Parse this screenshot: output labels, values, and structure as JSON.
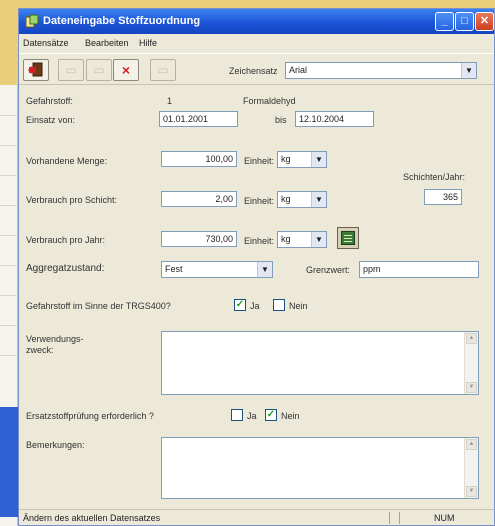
{
  "window": {
    "title": "Dateneingabe Stoffzuordnung"
  },
  "menu": [
    "Datensätze",
    "Bearbeiten",
    "Hilfe"
  ],
  "toolbar": {
    "delete_label": "×",
    "font_label": "Zeichensatz",
    "font_value": "Arial"
  },
  "form": {
    "gefahrstoff_label": "Gefahrstoff:",
    "gefahrstoff_value": "1",
    "gefahrstoff_name": "Formaldehyd",
    "einsatz_label": "Einsatz von:",
    "einsatz_von": "01.01.2001",
    "bis_label": "bis",
    "einsatz_bis": "12.10.2004",
    "menge_label": "Vorhandene Menge:",
    "menge_value": "100,00",
    "einheit_label": "Einheit:",
    "einheit_menge": "kg",
    "schichten_label": "Schichten/Jahr:",
    "schichten_value": "365",
    "schicht_label": "Verbrauch pro Schicht:",
    "schicht_value": "2,00",
    "einheit_schicht": "kg",
    "jahr_label": "Verbrauch pro Jahr:",
    "jahr_value": "730,00",
    "einheit_jahr": "kg",
    "aggregat_label": "Aggregatzustand:",
    "aggregat_value": "Fest",
    "grenzwert_label": "Grenzwert:",
    "grenzwert_value": "ppm",
    "trgs_label": "Gefahrstoff im Sinne der TRGS400?",
    "trgs_ja_label": "Ja",
    "trgs_ja": true,
    "trgs_nein_label": "Nein",
    "trgs_nein": false,
    "zweck_label": "Verwendungs- zweck:",
    "ersatz_label": "Ersatzstoffprüfung erforderlich ?",
    "ersatz_ja_label": "Ja",
    "ersatz_ja": false,
    "ersatz_nein_label": "Nein",
    "ersatz_nein": true,
    "bemerkungen_label": "Bemerkungen:"
  },
  "status": {
    "text": "Ändern des aktuellen Datensatzes",
    "num": "NUM"
  },
  "colors": {
    "titlebar": "#1c55d8",
    "window": "#ece9d8",
    "background": "#e9cf79",
    "check": "#21a121"
  },
  "icons": [
    "app-icon",
    "minimize-icon",
    "maximize-icon",
    "close-icon",
    "exit-door-icon",
    "delete-icon",
    "calculator-icon"
  ]
}
